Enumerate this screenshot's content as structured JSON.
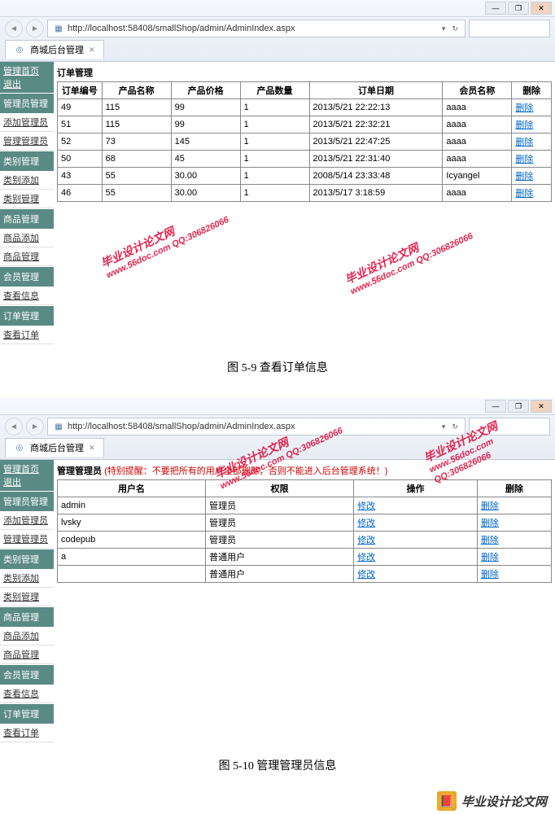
{
  "browser": {
    "url": "http://localhost:58408/smallShop/admin/AdminIndex.aspx",
    "tab_title": "商城后台管理"
  },
  "sidebar": {
    "top_links": [
      "管理首页",
      "退出"
    ],
    "sections": [
      {
        "title": "管理员管理",
        "items": [
          "添加管理员",
          "管理管理员"
        ]
      },
      {
        "title": "类别管理",
        "items": [
          "类别添加",
          "类别管理"
        ]
      },
      {
        "title": "商品管理",
        "items": [
          "商品添加",
          "商品管理"
        ]
      },
      {
        "title": "会员管理",
        "items": [
          "查看信息"
        ]
      },
      {
        "title": "订单管理",
        "items": [
          "查看订单"
        ]
      }
    ]
  },
  "screen1": {
    "title": "订单管理",
    "headers": [
      "订单编号",
      "产品名称",
      "产品价格",
      "产品数量",
      "订单日期",
      "会员名称",
      "删除"
    ],
    "rows": [
      [
        "49",
        "115",
        "99",
        "1",
        "2013/5/21 22:22:13",
        "aaaa",
        "删除"
      ],
      [
        "51",
        "115",
        "99",
        "1",
        "2013/5/21 22:32:21",
        "aaaa",
        "删除"
      ],
      [
        "52",
        "73",
        "145",
        "1",
        "2013/5/21 22:47:25",
        "aaaa",
        "删除"
      ],
      [
        "50",
        "68",
        "45",
        "1",
        "2013/5/21 22:31:40",
        "aaaa",
        "删除"
      ],
      [
        "43",
        "55",
        "30.00",
        "1",
        "2008/5/14 23:33:48",
        "Icyangel",
        "删除"
      ],
      [
        "46",
        "55",
        "30.00",
        "1",
        "2013/5/17 3:18:59",
        "aaaa",
        "删除"
      ]
    ]
  },
  "caption1": "图 5-9  查看订单信息",
  "screen2": {
    "title": "管理管理员",
    "warning": "(特别提醒：不要把所有的用户全部删除，否则不能进入后台管理系统！)",
    "headers": [
      "用户名",
      "权限",
      "操作",
      "删除"
    ],
    "rows": [
      [
        "admin",
        "管理员",
        "修改",
        "删除"
      ],
      [
        "lvsky",
        "管理员",
        "修改",
        "删除"
      ],
      [
        "codepub",
        "管理员",
        "修改",
        "删除"
      ],
      [
        "a",
        "普通用户",
        "修改",
        "删除"
      ],
      [
        "",
        "普通用户",
        "修改",
        "删除"
      ]
    ]
  },
  "caption2": "图 5-10  管理管理员信息",
  "watermark": {
    "line1": "毕业设计论文网",
    "line2": "www.56doc.com  QQ:306826066"
  },
  "footer": {
    "text": "毕业设计论文网"
  }
}
